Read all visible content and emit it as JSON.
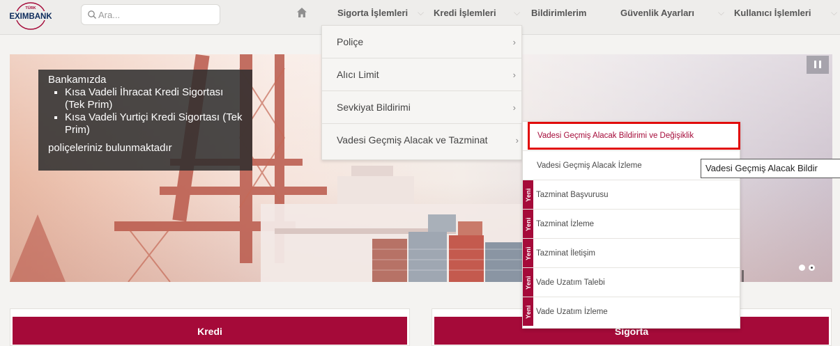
{
  "brand": {
    "logo_top": "TÜRK",
    "logo_main": "EXIMBANK",
    "accent": "#a50a39"
  },
  "search": {
    "placeholder": "Ara...",
    "icon": "search-icon"
  },
  "nav": {
    "home_icon": "home-icon",
    "items": [
      {
        "label": "Sigorta İşlemleri"
      },
      {
        "label": "Kredi İşlemleri"
      },
      {
        "label": "Bildirimlerim"
      },
      {
        "label": "Güvenlik Ayarları"
      },
      {
        "label": "Kullanıcı İşlemleri"
      }
    ]
  },
  "hero": {
    "promo_intro": "Bankamızda",
    "promo_items": [
      "Kısa Vadeli İhracat Kredi Sigortası (Tek Prim)",
      "Kısa Vadeli Yurtiçi Kredi Sigortası (Tek Prim)"
    ],
    "promo_outro": "poliçeleriniz bulunmaktadır",
    "pause_icon": "pause-icon",
    "slide_count": 2,
    "active_slide": 2
  },
  "menu": {
    "items": [
      {
        "label": "Poliçe",
        "arrow": "›"
      },
      {
        "label": "Alıcı Limit",
        "arrow": "›"
      },
      {
        "label": "Sevkiyat Bildirimi",
        "arrow": "›"
      },
      {
        "label": "Vadesi Geçmiş Alacak ve Tazminat",
        "arrow": "›"
      }
    ]
  },
  "submenu": {
    "new_tag": "Yeni",
    "items": [
      {
        "label": "Vadesi Geçmiş Alacak Bildirimi ve Değişiklik",
        "new": false
      },
      {
        "label": "Vadesi Geçmiş Alacak İzleme",
        "new": false
      },
      {
        "label": "Tazminat Başvurusu",
        "new": true
      },
      {
        "label": "Tazminat İzleme",
        "new": true
      },
      {
        "label": "Tazminat İletişim",
        "new": true
      },
      {
        "label": "Vade Uzatım Talebi",
        "new": true
      },
      {
        "label": "Vade Uzatım İzleme",
        "new": true
      }
    ]
  },
  "tooltip": {
    "text": "Vadesi Geçmiş Alacak Bildir"
  },
  "sections": {
    "kredi": "Kredi",
    "sigorta": "Sigorta"
  }
}
